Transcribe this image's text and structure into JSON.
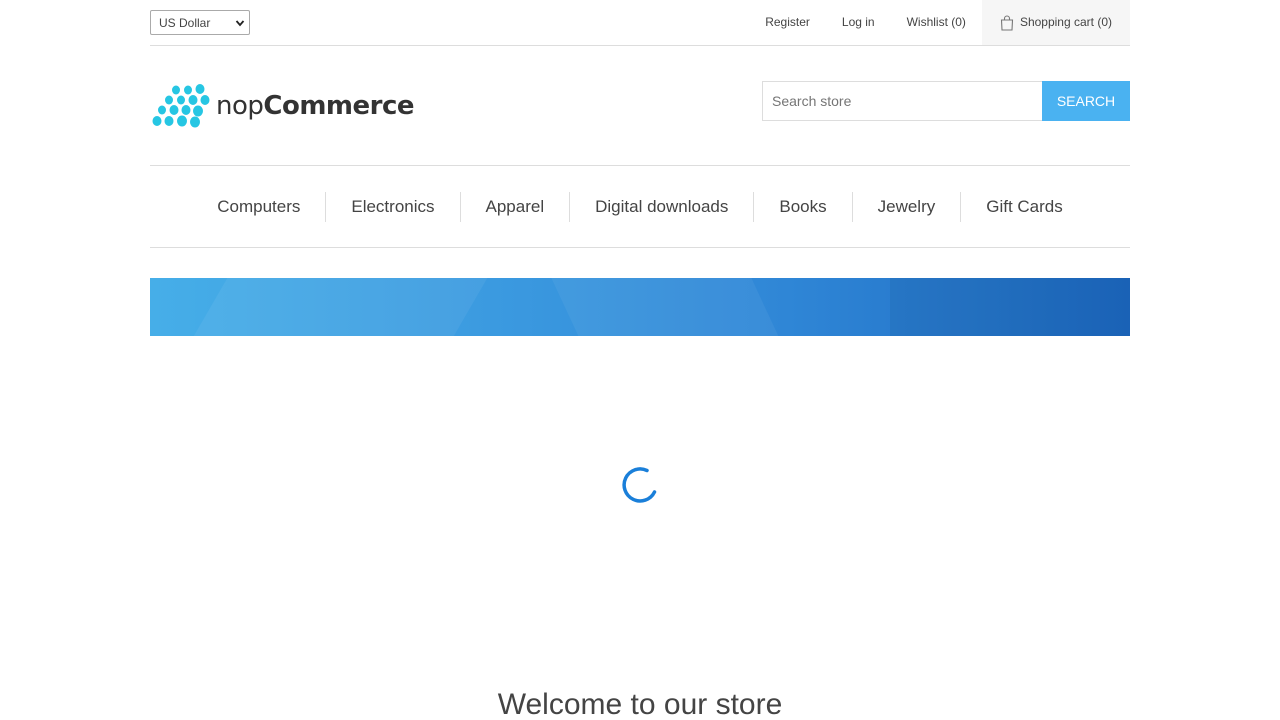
{
  "header": {
    "currency": "US Dollar",
    "links": {
      "register": "Register",
      "login": "Log in",
      "wishlist": "Wishlist (0)",
      "cart": "Shopping cart (0)"
    }
  },
  "logo": {
    "part1": "nop",
    "part2": "Commerce"
  },
  "search": {
    "placeholder": "Search store",
    "button": "Search"
  },
  "menu": {
    "items": [
      "Computers",
      "Electronics",
      "Apparel",
      "Digital downloads",
      "Books",
      "Jewelry",
      "Gift Cards"
    ]
  },
  "main": {
    "welcome": "Welcome to our store"
  },
  "colors": {
    "accent": "#4ab2f1",
    "spinner": "#1a7fd9",
    "logo_dots": "#26c6e3"
  },
  "icons": {
    "cart": "shopping-bag-icon",
    "spinner": "loading-spinner-icon",
    "logo": "nopcommerce-dots-logo"
  }
}
